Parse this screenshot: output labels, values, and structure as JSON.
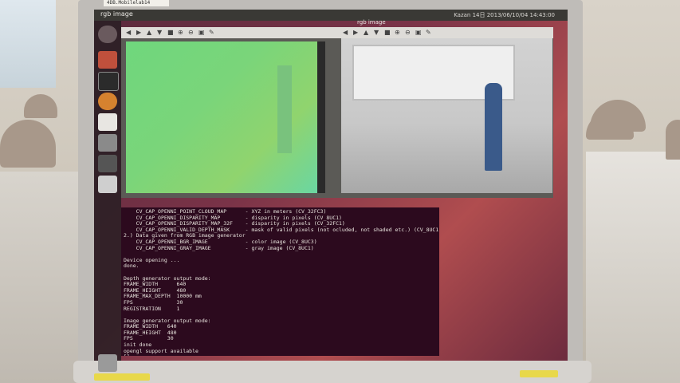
{
  "asset_tag": "4DB.Mobilelab14",
  "topbar": {
    "title": "rgb image",
    "status": "Kazan 14日 2013/06/10/04 14:43:00"
  },
  "rgb_window": {
    "title": "rgb image"
  },
  "terminal_lines": [
    "    CV_CAP_OPENNI_POINT_CLOUD_MAP      - XYZ in meters (CV_32FC3)",
    "    CV_CAP_OPENNI_DISPARITY_MAP        - disparity in pixels (CV_8UC1)",
    "    CV_CAP_OPENNI_DISPARITY_MAP_32F    - disparity in pixels (CV_32FC1)",
    "    CV_CAP_OPENNI_VALID_DEPTH_MASK     - mask of valid pixels (not ocluded, not shaded etc.) (CV_8UC1)",
    "2.) Data given from RGB image generator",
    "    CV_CAP_OPENNI_BGR_IMAGE            - color image (CV_8UC3)",
    "    CV_CAP_OPENNI_GRAY_IMAGE           - gray image (CV_8UC1)",
    "",
    "Device opening ...",
    "done.",
    "",
    "Depth generator output mode:",
    "FRAME_WIDTH      640",
    "FRAME_HEIGHT     480",
    "FRAME_MAX_DEPTH  10000 mm",
    "FPS              30",
    "REGISTRATION     1",
    "",
    "Image generator output mode:",
    "FRAME_WIDTH   640",
    "FRAME_HEIGHT  480",
    "FPS           30",
    "init done",
    "opengl support available",
    "[]"
  ]
}
